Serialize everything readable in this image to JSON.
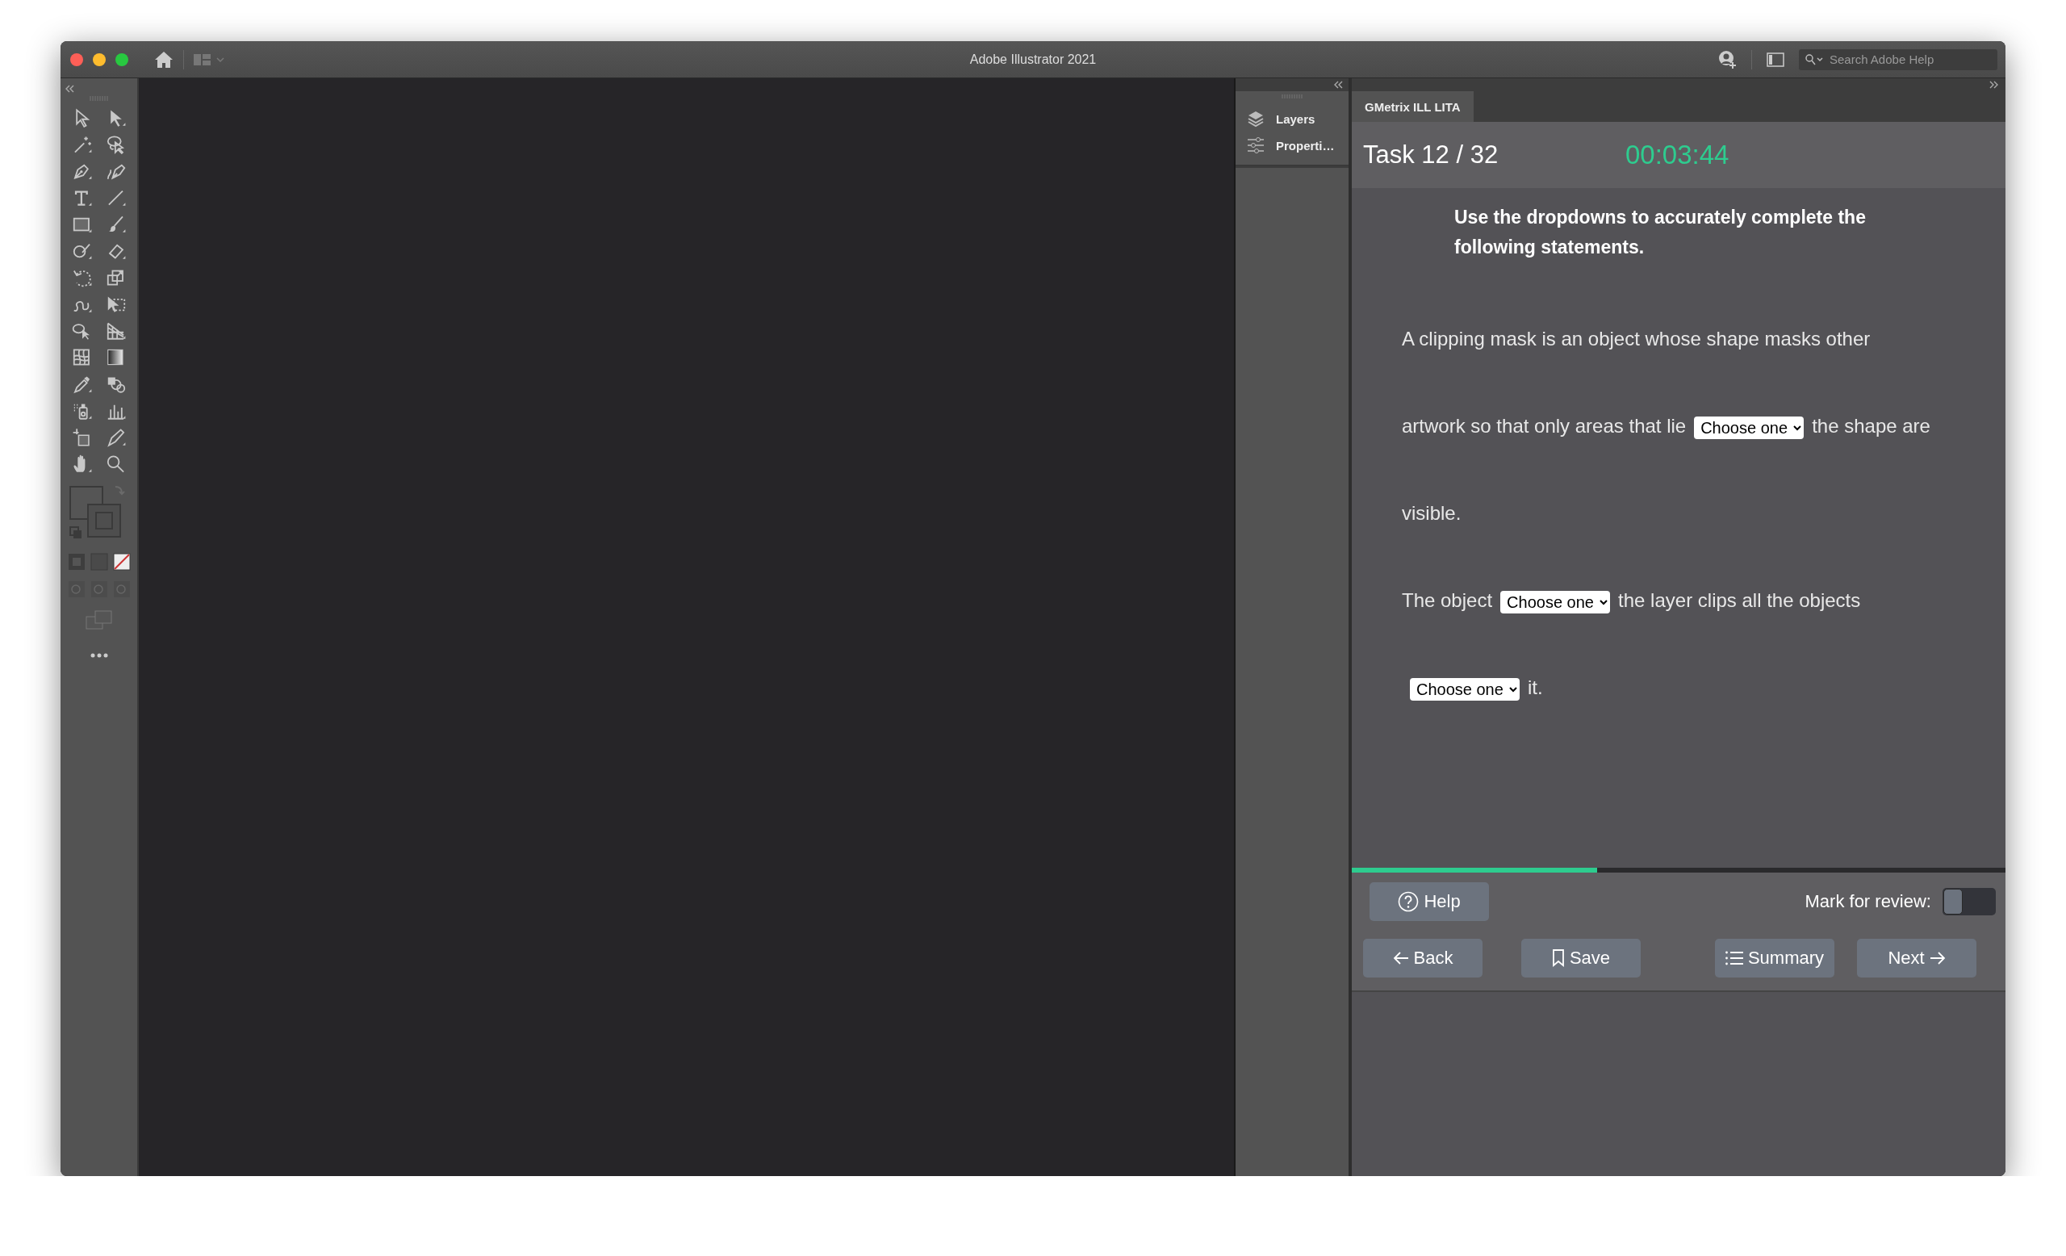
{
  "window": {
    "title": "Adobe Illustrator 2021"
  },
  "help_search": {
    "placeholder": "Search Adobe Help"
  },
  "panel_dock": {
    "items": [
      {
        "kind": "layers",
        "label": "Layers"
      },
      {
        "kind": "properties",
        "label": "Properti…"
      }
    ]
  },
  "task_panel": {
    "tab": {
      "label": "GMetrix ILL LITA",
      "selected": true
    },
    "task": "Task 12 / 32",
    "timer": "00:03:44",
    "instruction": "Use the dropdowns to accurately complete the following statements.",
    "statements": [
      {
        "lines": [
          [
            {
              "kind": "text",
              "text": "A clipping mask is an object whose shape masks other"
            }
          ],
          [
            {
              "kind": "text",
              "text": "artwork so that only areas that lie"
            },
            {
              "kind": "select",
              "value": "Choose one"
            },
            {
              "kind": "text",
              "text": "the shape are"
            }
          ],
          [
            {
              "kind": "text",
              "text": "visible."
            }
          ]
        ]
      },
      {
        "lines": [
          [
            {
              "kind": "text",
              "text": "The object"
            },
            {
              "kind": "select",
              "value": "Choose one"
            },
            {
              "kind": "text",
              "text": "the layer clips all the objects"
            }
          ],
          [
            {
              "kind": "select",
              "value": "Choose one"
            },
            {
              "kind": "text",
              "text": "it."
            }
          ]
        ]
      }
    ],
    "progress": {
      "level": 0.375
    },
    "help_button": "Help",
    "mark_for_review": {
      "label": "Mark for review:",
      "on": false
    },
    "buttons": [
      {
        "kind": "back",
        "label": "Back"
      },
      {
        "kind": "save",
        "label": "Save"
      },
      {
        "kind": "summary",
        "label": "Summary"
      },
      {
        "kind": "next",
        "label": "Next"
      }
    ]
  }
}
